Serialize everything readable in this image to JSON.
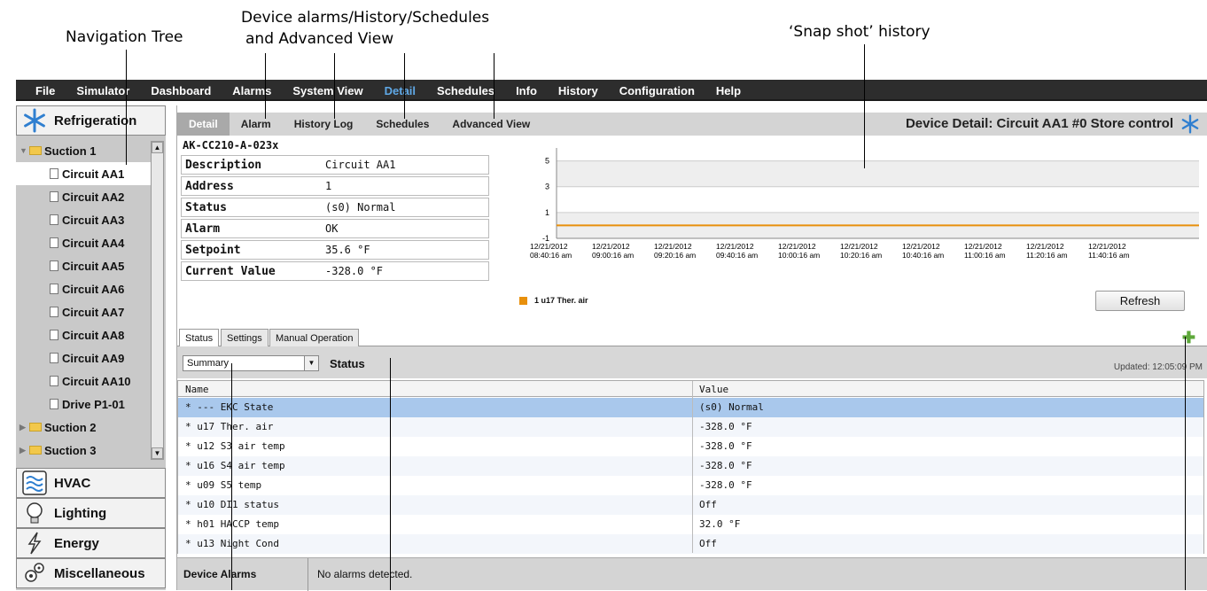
{
  "callouts": {
    "nav_tree": "Navigation Tree",
    "device_line1": "Device alarms/History/Schedules",
    "device_line2": "and Advanced View",
    "snapshot": "‘Snap shot’ history"
  },
  "menu": [
    "File",
    "Simulator",
    "Dashboard",
    "Alarms",
    "System View",
    "Detail",
    "Schedules",
    "Info",
    "History",
    "Configuration",
    "Help"
  ],
  "menu_active": "Detail",
  "nav": {
    "categories": [
      {
        "label": "Refrigeration",
        "icon": "snowflake-icon"
      },
      {
        "label": "HVAC",
        "icon": "hvac-icon"
      },
      {
        "label": "Lighting",
        "icon": "bulb-icon"
      },
      {
        "label": "Energy",
        "icon": "lightning-icon"
      },
      {
        "label": "Miscellaneous",
        "icon": "gears-icon"
      }
    ],
    "tree": [
      {
        "label": "Suction 1",
        "type": "folder",
        "open": true
      },
      {
        "label": "Circuit AA1",
        "type": "doc",
        "selected": true
      },
      {
        "label": "Circuit AA2",
        "type": "doc"
      },
      {
        "label": "Circuit AA3",
        "type": "doc"
      },
      {
        "label": "Circuit AA4",
        "type": "doc"
      },
      {
        "label": "Circuit AA5",
        "type": "doc"
      },
      {
        "label": "Circuit AA6",
        "type": "doc"
      },
      {
        "label": "Circuit AA7",
        "type": "doc"
      },
      {
        "label": "Circuit AA8",
        "type": "doc"
      },
      {
        "label": "Circuit AA9",
        "type": "doc"
      },
      {
        "label": "Circuit AA10",
        "type": "doc"
      },
      {
        "label": "Drive P1-01",
        "type": "doc"
      },
      {
        "label": "Suction 2",
        "type": "folder",
        "open": false
      },
      {
        "label": "Suction 3",
        "type": "folder",
        "open": false
      }
    ]
  },
  "top_tabs": [
    "Detail",
    "Alarm",
    "History Log",
    "Schedules",
    "Advanced View"
  ],
  "device_title": "Device Detail: Circuit AA1  #0 Store control",
  "model": "AK-CC210-A-023x",
  "properties": [
    {
      "key": "Description",
      "value": "Circuit AA1"
    },
    {
      "key": "Address",
      "value": "1"
    },
    {
      "key": "Status",
      "value": "(s0) Normal"
    },
    {
      "key": "Alarm",
      "value": "OK"
    },
    {
      "key": "Setpoint",
      "value": "35.6 °F"
    },
    {
      "key": "Current Value",
      "value": "-328.0 °F"
    }
  ],
  "chart_data": {
    "type": "line",
    "y_ticks": [
      "5",
      "3",
      "1",
      "-1"
    ],
    "x": [
      "12/21/2012 08:40:16 am",
      "12/21/2012 09:00:16 am",
      "12/21/2012 09:20:16 am",
      "12/21/2012 09:40:16 am",
      "12/21/2012 10:00:16 am",
      "12/21/2012 10:20:16 am",
      "12/21/2012 10:40:16 am",
      "12/21/2012 11:00:16 am",
      "12/21/2012 11:20:16 am",
      "12/21/2012 11:40:16 am"
    ],
    "ylim": [
      -1,
      6
    ],
    "series": [
      {
        "name": "1 u17 Ther. air",
        "color": "#e8900c",
        "values": [
          0,
          0,
          0,
          0,
          0,
          0,
          0,
          0,
          0,
          0
        ]
      }
    ],
    "grid": true,
    "legend": "bottom-left"
  },
  "refresh_label": "Refresh",
  "sub_tabs": [
    "Status",
    "Settings",
    "Manual Operation"
  ],
  "summary_value": "Summary",
  "status_label": "Status",
  "updated": "Updated: 12:05:09 PM",
  "table": {
    "headers": [
      "Name",
      "Value"
    ],
    "rows": [
      {
        "name": "* --- EKC State",
        "value": "(s0) Normal"
      },
      {
        "name": "* u17 Ther. air",
        "value": "-328.0 °F"
      },
      {
        "name": "* u12 S3 air temp",
        "value": "-328.0 °F"
      },
      {
        "name": "* u16 S4 air temp",
        "value": "-328.0 °F"
      },
      {
        "name": "* u09 S5 temp",
        "value": "-328.0 °F"
      },
      {
        "name": "* u10 DI1 status",
        "value": "Off"
      },
      {
        "name": "* h01 HACCP temp",
        "value": "32.0 °F"
      },
      {
        "name": "* u13 Night Cond",
        "value": "Off"
      }
    ]
  },
  "alarms": {
    "label": "Device Alarms",
    "text": "No alarms detected."
  }
}
